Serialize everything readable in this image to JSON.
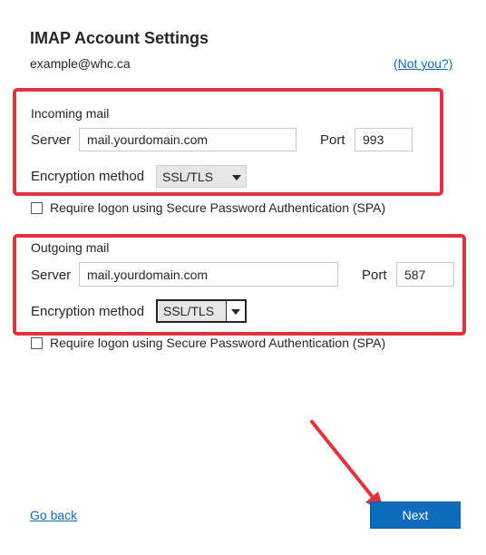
{
  "header": {
    "title": "IMAP Account Settings",
    "email": "example@whc.ca",
    "not_you_link": "(Not you?)"
  },
  "incoming": {
    "section_label": "Incoming mail",
    "server_label": "Server",
    "server_value": "mail.yourdomain.com",
    "port_label": "Port",
    "port_value": "993",
    "encryption_label": "Encryption method",
    "encryption_value": "SSL/TLS",
    "spa_label": "Require logon using Secure Password Authentication (SPA)",
    "spa_checked": false
  },
  "outgoing": {
    "section_label": "Outgoing mail",
    "server_label": "Server",
    "server_value": "mail.yourdomain.com",
    "port_label": "Port",
    "port_value": "587",
    "encryption_label": "Encryption method",
    "encryption_value": "SSL/TLS",
    "spa_label": "Require logon using Secure Password Authentication (SPA)",
    "spa_checked": false
  },
  "footer": {
    "go_back_label": "Go back",
    "next_label": "Next"
  },
  "colors": {
    "accent": "#0f6cbd",
    "highlight": "#e0333f",
    "arrow": "#e0333f"
  },
  "icons": {
    "dropdown": "chevron-down-icon",
    "annotation": "arrow-annotation-icon"
  }
}
